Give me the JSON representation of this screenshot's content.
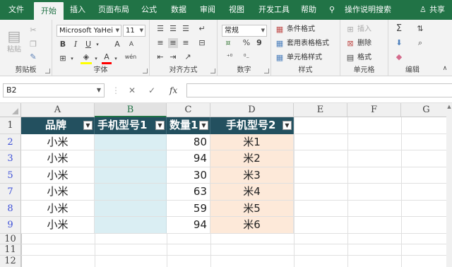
{
  "tabs": [
    {
      "label": "文件",
      "active": false
    },
    {
      "label": "开始",
      "active": true
    },
    {
      "label": "插入",
      "active": false
    },
    {
      "label": "页面布局",
      "active": false
    },
    {
      "label": "公式",
      "active": false
    },
    {
      "label": "数据",
      "active": false
    },
    {
      "label": "审阅",
      "active": false
    },
    {
      "label": "视图",
      "active": false
    },
    {
      "label": "开发工具",
      "active": false
    },
    {
      "label": "帮助",
      "active": false
    }
  ],
  "tell_me": "操作说明搜索",
  "share": "共享",
  "ribbon": {
    "clipboard": {
      "label": "剪贴板",
      "paste": "粘贴"
    },
    "font": {
      "label": "字体",
      "font_name": "Microsoft YaHei",
      "font_size": "11",
      "bold": "B",
      "italic": "I",
      "underline": "U",
      "grow": "A",
      "shrink": "A",
      "wen": "wén"
    },
    "alignment": {
      "label": "对齐方式"
    },
    "number": {
      "label": "数字",
      "format": "常规",
      "percent": "%",
      "comma": "9"
    },
    "styles": {
      "label": "样式",
      "conditional": "条件格式",
      "table_format": "套用表格格式",
      "cell_styles": "单元格样式"
    },
    "cells": {
      "label": "单元格",
      "insert": "插入",
      "delete": "删除",
      "format": "格式"
    },
    "editing": {
      "label": "编辑"
    }
  },
  "formula_bar": {
    "name_box": "B2",
    "cancel": "✕",
    "enter": "✓",
    "fx": "fx",
    "value": ""
  },
  "columns": [
    "A",
    "B",
    "C",
    "D",
    "E",
    "F",
    "G"
  ],
  "selected_column": "B",
  "rows": [
    {
      "row": "1",
      "filtered": false
    },
    {
      "row": "2",
      "filtered": true
    },
    {
      "row": "3",
      "filtered": true
    },
    {
      "row": "5",
      "filtered": true
    },
    {
      "row": "7",
      "filtered": true
    },
    {
      "row": "8",
      "filtered": true
    },
    {
      "row": "9",
      "filtered": true
    },
    {
      "row": "10",
      "filtered": false
    },
    {
      "row": "11",
      "filtered": false
    },
    {
      "row": "12",
      "filtered": false
    }
  ],
  "table": {
    "headers": [
      "品牌",
      "手机型号1",
      "数量1",
      "手机型号2"
    ],
    "data": [
      [
        "小米",
        "",
        "80",
        "米1"
      ],
      [
        "小米",
        "",
        "94",
        "米2"
      ],
      [
        "小米",
        "",
        "30",
        "米3"
      ],
      [
        "小米",
        "",
        "63",
        "米4"
      ],
      [
        "小米",
        "",
        "59",
        "米5"
      ],
      [
        "小米",
        "",
        "94",
        "米6"
      ]
    ]
  },
  "colors": {
    "accent": "#217346",
    "header_fill": "#23505f",
    "col_b_fill": "#daeef3",
    "col_d_fill": "#fde9d9",
    "filtered_row_num": "#3c4fd8"
  }
}
